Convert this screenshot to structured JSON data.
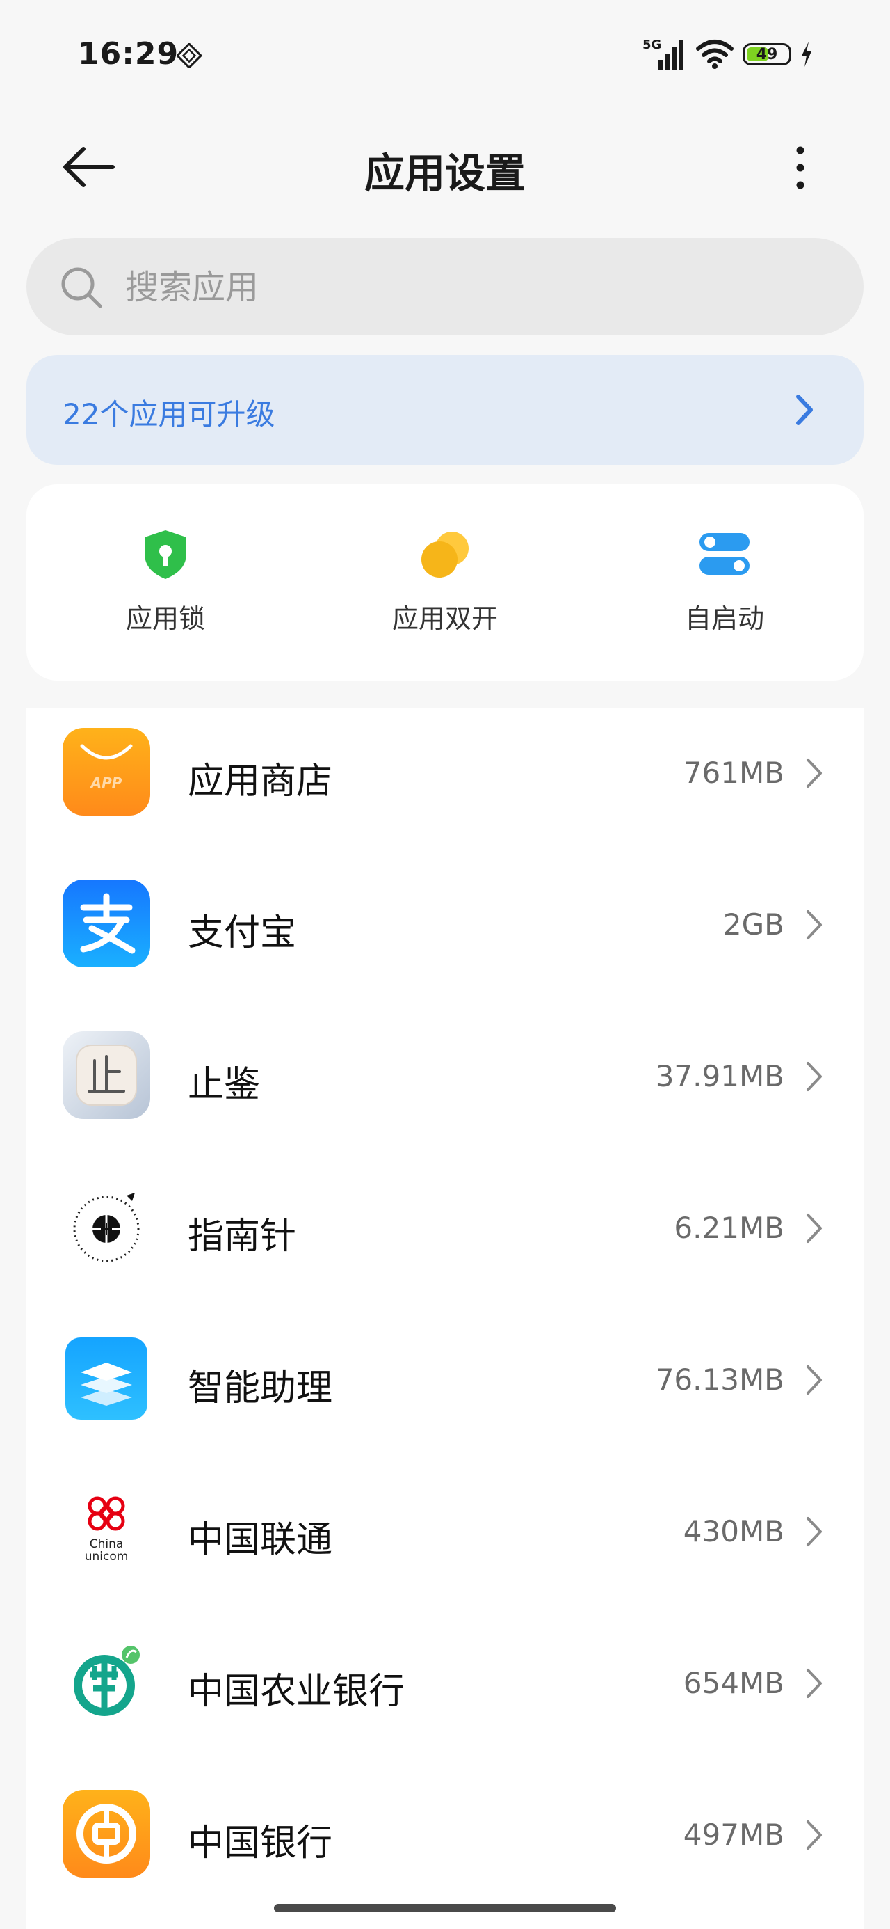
{
  "status_bar": {
    "time": "16:29",
    "network": "5G",
    "battery": "49",
    "battery_level": 0.49,
    "icons": [
      "nfc-icon",
      "signal-icon",
      "wifi-icon",
      "battery-icon",
      "charging-icon"
    ]
  },
  "header": {
    "title": "应用设置",
    "back_icon": "arrow-left-icon",
    "more_icon": "more-vertical-icon"
  },
  "search": {
    "placeholder": "搜索应用",
    "icon": "search-icon"
  },
  "upgrade_banner": {
    "text": "22个应用可升级",
    "accent": "#3a7be0"
  },
  "shortcuts": [
    {
      "label": "应用锁",
      "icon": "shield-lock-icon",
      "color": "#2fbf4a"
    },
    {
      "label": "应用双开",
      "icon": "dual-app-icon",
      "color": "#f6b519"
    },
    {
      "label": "自启动",
      "icon": "toggle-icon",
      "color": "#2b9bf0"
    }
  ],
  "apps": [
    {
      "name": "应用商店",
      "size": "761MB",
      "icon": "app-store-icon"
    },
    {
      "name": "支付宝",
      "size": "2GB",
      "icon": "alipay-icon"
    },
    {
      "name": "止鉴",
      "size": "37.91MB",
      "icon": "zhijian-icon"
    },
    {
      "name": "指南针",
      "size": "6.21MB",
      "icon": "compass-icon"
    },
    {
      "name": "智能助理",
      "size": "76.13MB",
      "icon": "assistant-icon"
    },
    {
      "name": "中国联通",
      "size": "430MB",
      "icon": "china-unicom-icon"
    },
    {
      "name": "中国农业银行",
      "size": "654MB",
      "icon": "abc-bank-icon"
    },
    {
      "name": "中国银行",
      "size": "497MB",
      "icon": "boc-bank-icon"
    }
  ]
}
